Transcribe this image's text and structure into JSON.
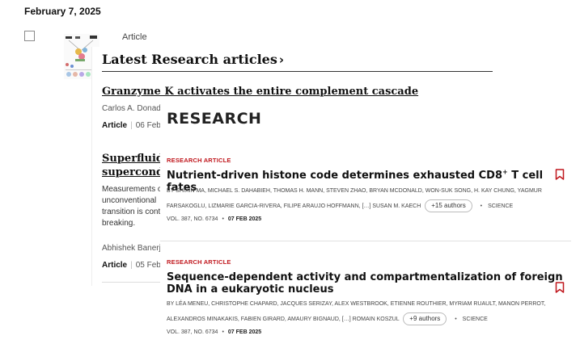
{
  "date": "February 7, 2025",
  "article_type": "Article",
  "latest": {
    "title": "Latest Research articles",
    "chevron": "›",
    "items": [
      {
        "title": "Granzyme K activates the entire complement cascade",
        "authors": "Carlos A. Donad",
        "authors_partial_overlap": "…",
        "kind": "Article",
        "date": "06 Feb"
      },
      {
        "title_line1": "Superfluid",
        "title_line2": "supercond",
        "abstract": "Measurements of unconventional transition is cont breaking.",
        "authors": "Abhishek Banerj",
        "kind": "Article",
        "date": "05 Feb"
      }
    ]
  },
  "research": {
    "heading": "RESEARCH",
    "items": [
      {
        "kind": "RESEARCH ARTICLE",
        "title_pre": "Nutrient-driven histone code determines exhausted CD8",
        "title_sup": "+",
        "title_post": " T cell fates",
        "authors_line1": "BY SHIXIN MA, MICHAEL S. DAHABIEH, THOMAS H. MANN, STEVEN ZHAO, BRYAN MCDONALD, WON-SUK SONG, H. KAY CHUNG, YAGMUR",
        "authors_line2": "FARSAKOGLU, LIZMARIE GARCIA-RIVERA, FILIPE ARAUJO HOFFMANN, […] SUSAN M. KAECH",
        "more": "+15 authors",
        "journal": "SCIENCE",
        "volume": "VOL. 387, NO. 6734",
        "date": "07 FEB 2025"
      },
      {
        "kind": "RESEARCH ARTICLE",
        "title_line1": "Sequence-dependent activity and compartmentalization of foreign",
        "title_line2": "DNA in a eukaryotic nucleus",
        "authors_line1": "BY LÉA MENEU, CHRISTOPHE CHAPARD, JACQUES SERIZAY, ALEX WESTBROOK, ETIENNE ROUTHIER, MYRIAM RUAULT, MANON PERROT,",
        "authors_line2": "ALEXANDROS MINAKAKIS, FABIEN GIRARD, AMAURY BIGNAUD, […] ROMAIN KOSZUL",
        "more": "+9 authors",
        "journal": "SCIENCE",
        "volume": "VOL. 387, NO. 6734",
        "date": "07 FEB 2025"
      }
    ]
  },
  "colors": {
    "accent_red": "#c0171d",
    "text": "#1a1a1a"
  },
  "icons": {
    "bookmark": "bookmark-icon",
    "chevron": "chevron-right-icon",
    "checkbox": "checkbox-icon"
  }
}
